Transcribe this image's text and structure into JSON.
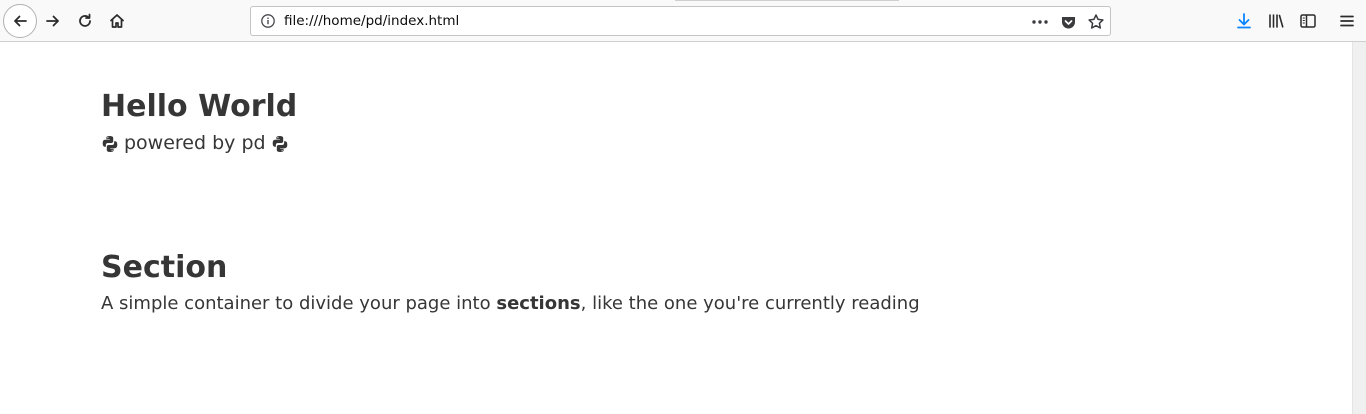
{
  "browser": {
    "url": "file:///home/pd/index.html",
    "icons": {
      "back": "back-arrow-icon",
      "forward": "forward-arrow-icon",
      "reload": "reload-icon",
      "home": "home-icon",
      "info": "info-icon",
      "more": "more-dots-icon",
      "pocket": "pocket-icon",
      "bookmark": "star-icon",
      "downloads": "download-icon",
      "library": "library-icon",
      "sidebar": "sidebar-icon",
      "menu": "hamburger-menu-icon"
    },
    "download_accent": "#0a84ff"
  },
  "page": {
    "hero": {
      "title": "Hello World",
      "subtitle": "powered by pd",
      "subtitle_icon": "python-icon"
    },
    "section": {
      "title": "Section",
      "text_before": "A simple container to divide your page into ",
      "text_bold": "sections",
      "text_after": ", like the one you're currently reading"
    },
    "text_color": "#363636"
  }
}
